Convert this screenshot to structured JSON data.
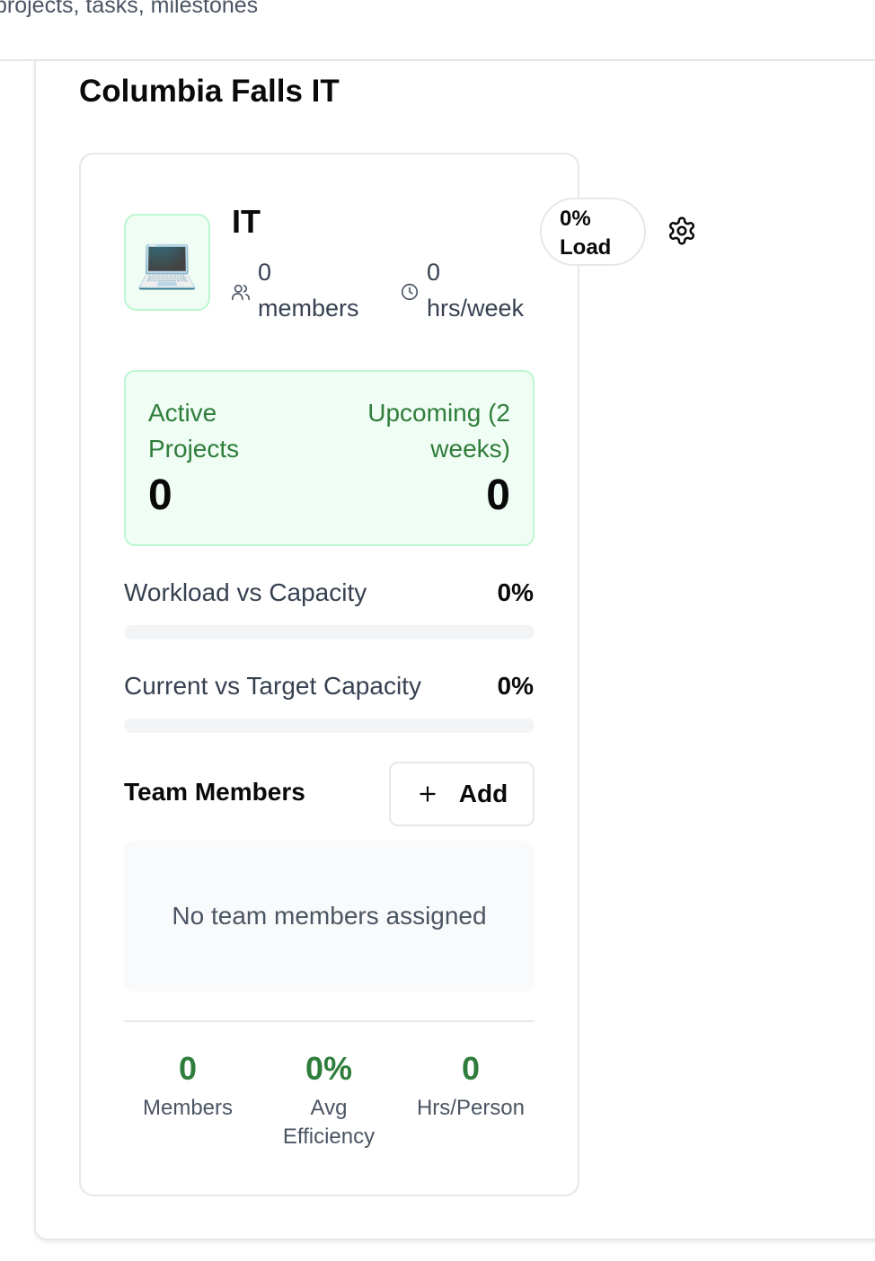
{
  "header": {
    "subtitle": "projects, tasks, milestones"
  },
  "page": {
    "title": "Columbia Falls IT"
  },
  "team": {
    "icon": "laptop-icon",
    "icon_glyph": "💻",
    "name": "IT",
    "members_count": "0",
    "members_unit": "members",
    "hours_count": "0",
    "hours_unit": "hrs/week",
    "load_value": "0%",
    "load_label": "Load"
  },
  "stats": {
    "active_label_line1": "Active",
    "active_label_line2": "Projects",
    "active_value": "0",
    "upcoming_label_line1": "Upcoming (2",
    "upcoming_label_line2": "weeks)",
    "upcoming_value": "0"
  },
  "metrics": {
    "workload_label": "Workload vs Capacity",
    "workload_value": "0%",
    "workload_fill": 0,
    "capacity_label": "Current vs Target Capacity",
    "capacity_value": "0%",
    "capacity_fill": 0
  },
  "members_section": {
    "heading": "Team Members",
    "add_label": "Add",
    "empty_text": "No team members assigned"
  },
  "footer": {
    "members_value": "0",
    "members_label": "Members",
    "efficiency_value": "0%",
    "efficiency_label_line1": "Avg",
    "efficiency_label_line2": "Efficiency",
    "hrs_value": "0",
    "hrs_label": "Hrs/Person"
  },
  "colors": {
    "accent_green": "#2f7d3b",
    "stats_bg": "#f0fdf4",
    "border": "#e5e7eb"
  }
}
